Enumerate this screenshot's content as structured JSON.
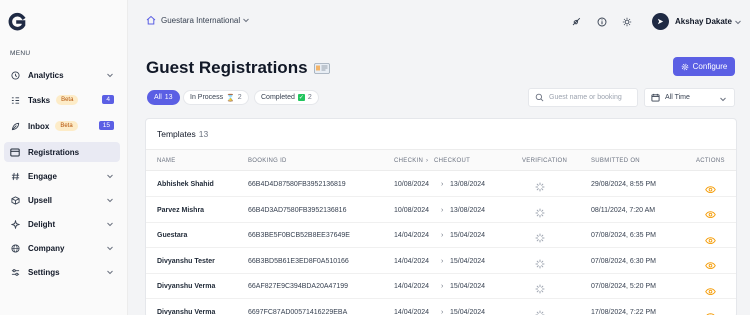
{
  "sidebar": {
    "menu_label": "MENU",
    "items": [
      {
        "label": "Analytics",
        "icon": "clock-icon",
        "chevron": true
      },
      {
        "label": "Tasks",
        "icon": "list-icon",
        "badge": "Beta",
        "count": "4"
      },
      {
        "label": "Inbox",
        "icon": "leaf-icon",
        "badge": "Beta",
        "count": "15"
      },
      {
        "label": "Registrations",
        "icon": "card-icon",
        "active": true
      },
      {
        "label": "Engage",
        "icon": "hash-icon",
        "chevron": true
      },
      {
        "label": "Upsell",
        "icon": "cube-icon",
        "chevron": true
      },
      {
        "label": "Delight",
        "icon": "sparkle-icon",
        "chevron": true
      },
      {
        "label": "Company",
        "icon": "globe-icon",
        "chevron": true
      },
      {
        "label": "Settings",
        "icon": "sliders-icon",
        "chevron": true
      }
    ]
  },
  "topbar": {
    "org_name": "Guestara International",
    "user_name": "Akshay Dakate"
  },
  "page": {
    "title": "Guest Registrations",
    "configure_label": "Configure"
  },
  "filters": {
    "all_label": "All",
    "all_count": "13",
    "in_process_label": "In Process",
    "in_process_count": "2",
    "completed_label": "Completed",
    "completed_count": "2",
    "search_placeholder": "Guest name or booking",
    "date_value": "All Time"
  },
  "table": {
    "title": "Templates",
    "count": "13",
    "headers": {
      "name": "NAME",
      "booking": "BOOKING ID",
      "checkin": "CHECKIN",
      "checkout": "CHECKOUT",
      "verification": "VERIFICATION",
      "submitted": "SUBMITTED ON",
      "actions": "ACTIONS"
    },
    "rows": [
      {
        "name": "Abhishek Shahid",
        "booking": "66B4D4D87580FB3952136819",
        "checkin": "10/08/2024",
        "checkout": "13/08/2024",
        "submitted": "29/08/2024, 8:55 PM"
      },
      {
        "name": "Parvez Mishra",
        "booking": "66B4D3AD7580FB3952136816",
        "checkin": "10/08/2024",
        "checkout": "13/08/2024",
        "submitted": "08/11/2024, 7:20 AM"
      },
      {
        "name": "Guestara",
        "booking": "66B3BE5F0BCB52B8EE37649E",
        "checkin": "14/04/2024",
        "checkout": "15/04/2024",
        "submitted": "07/08/2024, 6:35 PM"
      },
      {
        "name": "Divyanshu Tester",
        "booking": "66B3BD5B61E3ED8F0A510166",
        "checkin": "14/04/2024",
        "checkout": "15/04/2024",
        "submitted": "07/08/2024, 6:30 PM"
      },
      {
        "name": "Divyanshu Verma",
        "booking": "66AF827E9C394BDA20A47199",
        "checkin": "14/04/2024",
        "checkout": "15/04/2024",
        "submitted": "07/08/2024, 5:20 PM"
      },
      {
        "name": "Divyanshu Verma",
        "booking": "6697FC87AD00571416229EBA",
        "checkin": "14/04/2024",
        "checkout": "15/04/2024",
        "submitted": "17/08/2024, 7:22 PM"
      }
    ]
  },
  "colors": {
    "accent": "#5b5fe4",
    "action": "#f59e0b"
  }
}
